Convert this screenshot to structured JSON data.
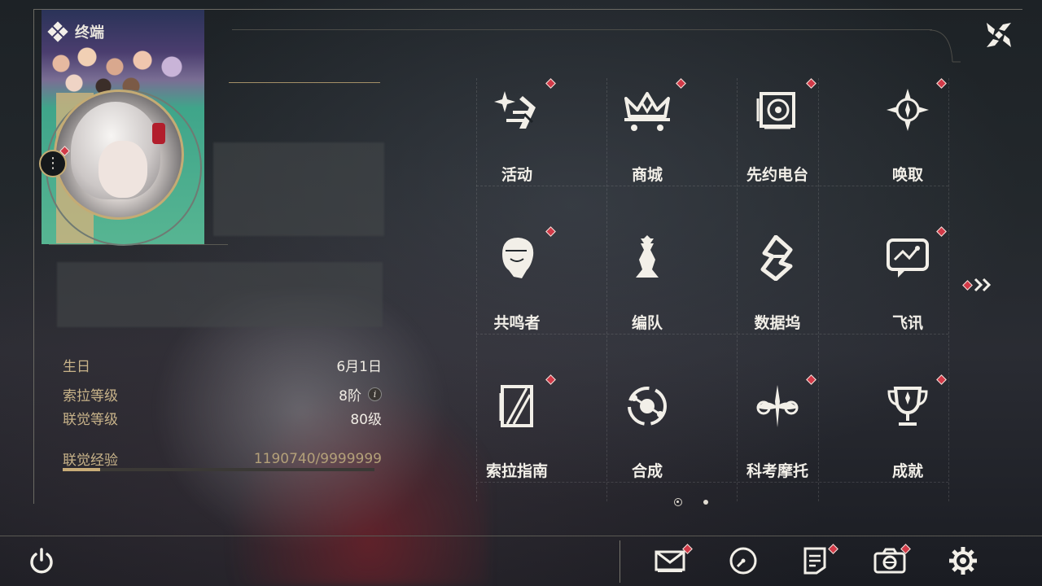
{
  "header": {
    "title": "终端",
    "close_icon": "close-x-icon"
  },
  "profile": {
    "menu_icon": "more-vertical-icon",
    "birthday_label": "生日",
    "birthday_value": "6月1日",
    "sola_level_label": "索拉等级",
    "sola_level_value": "8阶",
    "union_level_label": "联觉等级",
    "union_level_value": "80级",
    "union_exp_label": "联觉经验",
    "union_exp_value": "1190740/9999999",
    "union_exp_progress": 0.119
  },
  "menu": {
    "items": [
      {
        "label": "活动",
        "icon": "activity-sparkle-icon",
        "badge": true
      },
      {
        "label": "商城",
        "icon": "shop-cart-crown-icon",
        "badge": true
      },
      {
        "label": "先约电台",
        "icon": "radio-turntable-icon",
        "badge": true
      },
      {
        "label": "唤取",
        "icon": "convene-compass-icon",
        "badge": true
      },
      {
        "label": "共鸣者",
        "icon": "resonator-portrait-icon",
        "badge": true
      },
      {
        "label": "编队",
        "icon": "team-chess-icon",
        "badge": false
      },
      {
        "label": "数据坞",
        "icon": "data-dock-icon",
        "badge": false
      },
      {
        "label": "飞讯",
        "icon": "message-bubble-icon",
        "badge": true
      },
      {
        "label": "索拉指南",
        "icon": "guide-book-icon",
        "badge": true
      },
      {
        "label": "合成",
        "icon": "synthesis-orbit-icon",
        "badge": false
      },
      {
        "label": "科考摩托",
        "icon": "motorcycle-icon",
        "badge": true
      },
      {
        "label": "成就",
        "icon": "trophy-icon",
        "badge": true
      }
    ],
    "next_page_icon": "double-chevron-right-icon",
    "pages": 2,
    "current_page": 1
  },
  "bottombar": {
    "power_icon": "power-icon",
    "buttons": [
      {
        "name": "mail",
        "icon": "mail-icon",
        "badge": true
      },
      {
        "name": "clock",
        "icon": "clock-icon",
        "badge": false
      },
      {
        "name": "notice",
        "icon": "notice-document-icon",
        "badge": true
      },
      {
        "name": "camera",
        "icon": "camera-icon",
        "badge": true
      },
      {
        "name": "settings",
        "icon": "gear-icon",
        "badge": false
      }
    ]
  },
  "colors": {
    "accent_gold": "#c8ac78",
    "badge_red": "#d23a48",
    "text_light": "#f2efe8"
  }
}
